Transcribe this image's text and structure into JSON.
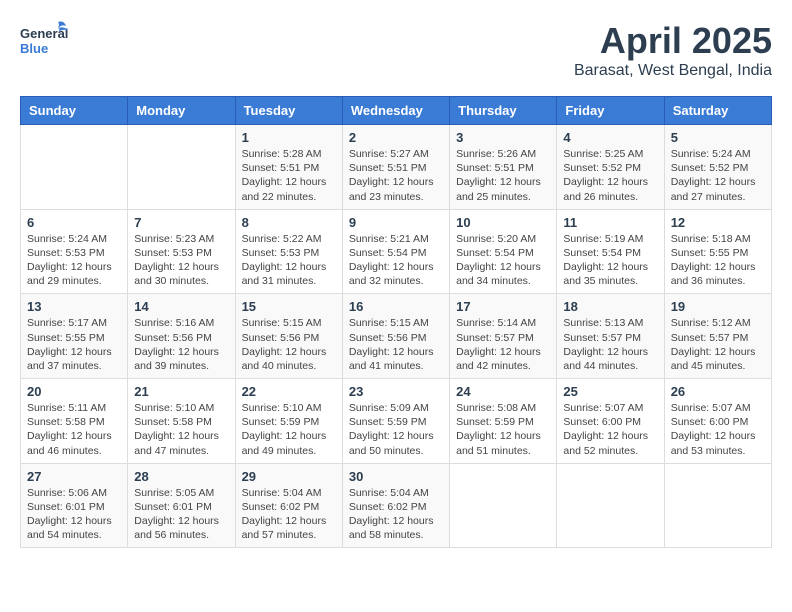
{
  "header": {
    "logo_line1": "General",
    "logo_line2": "Blue",
    "month_title": "April 2025",
    "location": "Barasat, West Bengal, India"
  },
  "weekdays": [
    "Sunday",
    "Monday",
    "Tuesday",
    "Wednesday",
    "Thursday",
    "Friday",
    "Saturday"
  ],
  "weeks": [
    [
      {
        "day": "",
        "sunrise": "",
        "sunset": "",
        "daylight": ""
      },
      {
        "day": "",
        "sunrise": "",
        "sunset": "",
        "daylight": ""
      },
      {
        "day": "1",
        "sunrise": "Sunrise: 5:28 AM",
        "sunset": "Sunset: 5:51 PM",
        "daylight": "Daylight: 12 hours and 22 minutes."
      },
      {
        "day": "2",
        "sunrise": "Sunrise: 5:27 AM",
        "sunset": "Sunset: 5:51 PM",
        "daylight": "Daylight: 12 hours and 23 minutes."
      },
      {
        "day": "3",
        "sunrise": "Sunrise: 5:26 AM",
        "sunset": "Sunset: 5:51 PM",
        "daylight": "Daylight: 12 hours and 25 minutes."
      },
      {
        "day": "4",
        "sunrise": "Sunrise: 5:25 AM",
        "sunset": "Sunset: 5:52 PM",
        "daylight": "Daylight: 12 hours and 26 minutes."
      },
      {
        "day": "5",
        "sunrise": "Sunrise: 5:24 AM",
        "sunset": "Sunset: 5:52 PM",
        "daylight": "Daylight: 12 hours and 27 minutes."
      }
    ],
    [
      {
        "day": "6",
        "sunrise": "Sunrise: 5:24 AM",
        "sunset": "Sunset: 5:53 PM",
        "daylight": "Daylight: 12 hours and 29 minutes."
      },
      {
        "day": "7",
        "sunrise": "Sunrise: 5:23 AM",
        "sunset": "Sunset: 5:53 PM",
        "daylight": "Daylight: 12 hours and 30 minutes."
      },
      {
        "day": "8",
        "sunrise": "Sunrise: 5:22 AM",
        "sunset": "Sunset: 5:53 PM",
        "daylight": "Daylight: 12 hours and 31 minutes."
      },
      {
        "day": "9",
        "sunrise": "Sunrise: 5:21 AM",
        "sunset": "Sunset: 5:54 PM",
        "daylight": "Daylight: 12 hours and 32 minutes."
      },
      {
        "day": "10",
        "sunrise": "Sunrise: 5:20 AM",
        "sunset": "Sunset: 5:54 PM",
        "daylight": "Daylight: 12 hours and 34 minutes."
      },
      {
        "day": "11",
        "sunrise": "Sunrise: 5:19 AM",
        "sunset": "Sunset: 5:54 PM",
        "daylight": "Daylight: 12 hours and 35 minutes."
      },
      {
        "day": "12",
        "sunrise": "Sunrise: 5:18 AM",
        "sunset": "Sunset: 5:55 PM",
        "daylight": "Daylight: 12 hours and 36 minutes."
      }
    ],
    [
      {
        "day": "13",
        "sunrise": "Sunrise: 5:17 AM",
        "sunset": "Sunset: 5:55 PM",
        "daylight": "Daylight: 12 hours and 37 minutes."
      },
      {
        "day": "14",
        "sunrise": "Sunrise: 5:16 AM",
        "sunset": "Sunset: 5:56 PM",
        "daylight": "Daylight: 12 hours and 39 minutes."
      },
      {
        "day": "15",
        "sunrise": "Sunrise: 5:15 AM",
        "sunset": "Sunset: 5:56 PM",
        "daylight": "Daylight: 12 hours and 40 minutes."
      },
      {
        "day": "16",
        "sunrise": "Sunrise: 5:15 AM",
        "sunset": "Sunset: 5:56 PM",
        "daylight": "Daylight: 12 hours and 41 minutes."
      },
      {
        "day": "17",
        "sunrise": "Sunrise: 5:14 AM",
        "sunset": "Sunset: 5:57 PM",
        "daylight": "Daylight: 12 hours and 42 minutes."
      },
      {
        "day": "18",
        "sunrise": "Sunrise: 5:13 AM",
        "sunset": "Sunset: 5:57 PM",
        "daylight": "Daylight: 12 hours and 44 minutes."
      },
      {
        "day": "19",
        "sunrise": "Sunrise: 5:12 AM",
        "sunset": "Sunset: 5:57 PM",
        "daylight": "Daylight: 12 hours and 45 minutes."
      }
    ],
    [
      {
        "day": "20",
        "sunrise": "Sunrise: 5:11 AM",
        "sunset": "Sunset: 5:58 PM",
        "daylight": "Daylight: 12 hours and 46 minutes."
      },
      {
        "day": "21",
        "sunrise": "Sunrise: 5:10 AM",
        "sunset": "Sunset: 5:58 PM",
        "daylight": "Daylight: 12 hours and 47 minutes."
      },
      {
        "day": "22",
        "sunrise": "Sunrise: 5:10 AM",
        "sunset": "Sunset: 5:59 PM",
        "daylight": "Daylight: 12 hours and 49 minutes."
      },
      {
        "day": "23",
        "sunrise": "Sunrise: 5:09 AM",
        "sunset": "Sunset: 5:59 PM",
        "daylight": "Daylight: 12 hours and 50 minutes."
      },
      {
        "day": "24",
        "sunrise": "Sunrise: 5:08 AM",
        "sunset": "Sunset: 5:59 PM",
        "daylight": "Daylight: 12 hours and 51 minutes."
      },
      {
        "day": "25",
        "sunrise": "Sunrise: 5:07 AM",
        "sunset": "Sunset: 6:00 PM",
        "daylight": "Daylight: 12 hours and 52 minutes."
      },
      {
        "day": "26",
        "sunrise": "Sunrise: 5:07 AM",
        "sunset": "Sunset: 6:00 PM",
        "daylight": "Daylight: 12 hours and 53 minutes."
      }
    ],
    [
      {
        "day": "27",
        "sunrise": "Sunrise: 5:06 AM",
        "sunset": "Sunset: 6:01 PM",
        "daylight": "Daylight: 12 hours and 54 minutes."
      },
      {
        "day": "28",
        "sunrise": "Sunrise: 5:05 AM",
        "sunset": "Sunset: 6:01 PM",
        "daylight": "Daylight: 12 hours and 56 minutes."
      },
      {
        "day": "29",
        "sunrise": "Sunrise: 5:04 AM",
        "sunset": "Sunset: 6:02 PM",
        "daylight": "Daylight: 12 hours and 57 minutes."
      },
      {
        "day": "30",
        "sunrise": "Sunrise: 5:04 AM",
        "sunset": "Sunset: 6:02 PM",
        "daylight": "Daylight: 12 hours and 58 minutes."
      },
      {
        "day": "",
        "sunrise": "",
        "sunset": "",
        "daylight": ""
      },
      {
        "day": "",
        "sunrise": "",
        "sunset": "",
        "daylight": ""
      },
      {
        "day": "",
        "sunrise": "",
        "sunset": "",
        "daylight": ""
      }
    ]
  ]
}
